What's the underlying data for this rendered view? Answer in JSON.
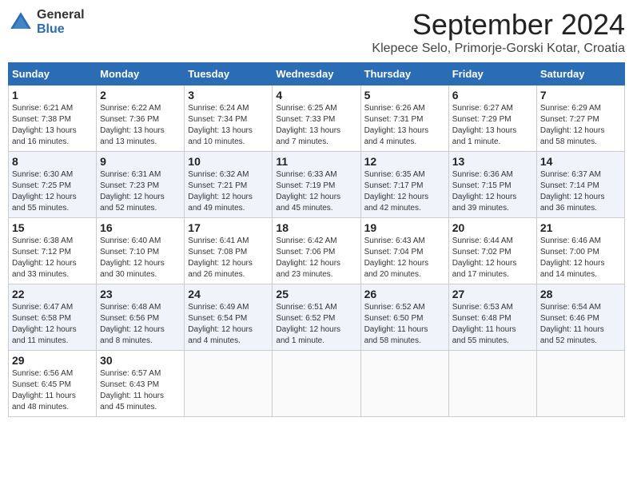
{
  "header": {
    "logo_general": "General",
    "logo_blue": "Blue",
    "month": "September 2024",
    "location": "Klepece Selo, Primorje-Gorski Kotar, Croatia"
  },
  "weekdays": [
    "Sunday",
    "Monday",
    "Tuesday",
    "Wednesday",
    "Thursday",
    "Friday",
    "Saturday"
  ],
  "weeks": [
    [
      {
        "day": "1",
        "info": "Sunrise: 6:21 AM\nSunset: 7:38 PM\nDaylight: 13 hours\nand 16 minutes."
      },
      {
        "day": "2",
        "info": "Sunrise: 6:22 AM\nSunset: 7:36 PM\nDaylight: 13 hours\nand 13 minutes."
      },
      {
        "day": "3",
        "info": "Sunrise: 6:24 AM\nSunset: 7:34 PM\nDaylight: 13 hours\nand 10 minutes."
      },
      {
        "day": "4",
        "info": "Sunrise: 6:25 AM\nSunset: 7:33 PM\nDaylight: 13 hours\nand 7 minutes."
      },
      {
        "day": "5",
        "info": "Sunrise: 6:26 AM\nSunset: 7:31 PM\nDaylight: 13 hours\nand 4 minutes."
      },
      {
        "day": "6",
        "info": "Sunrise: 6:27 AM\nSunset: 7:29 PM\nDaylight: 13 hours\nand 1 minute."
      },
      {
        "day": "7",
        "info": "Sunrise: 6:29 AM\nSunset: 7:27 PM\nDaylight: 12 hours\nand 58 minutes."
      }
    ],
    [
      {
        "day": "8",
        "info": "Sunrise: 6:30 AM\nSunset: 7:25 PM\nDaylight: 12 hours\nand 55 minutes."
      },
      {
        "day": "9",
        "info": "Sunrise: 6:31 AM\nSunset: 7:23 PM\nDaylight: 12 hours\nand 52 minutes."
      },
      {
        "day": "10",
        "info": "Sunrise: 6:32 AM\nSunset: 7:21 PM\nDaylight: 12 hours\nand 49 minutes."
      },
      {
        "day": "11",
        "info": "Sunrise: 6:33 AM\nSunset: 7:19 PM\nDaylight: 12 hours\nand 45 minutes."
      },
      {
        "day": "12",
        "info": "Sunrise: 6:35 AM\nSunset: 7:17 PM\nDaylight: 12 hours\nand 42 minutes."
      },
      {
        "day": "13",
        "info": "Sunrise: 6:36 AM\nSunset: 7:15 PM\nDaylight: 12 hours\nand 39 minutes."
      },
      {
        "day": "14",
        "info": "Sunrise: 6:37 AM\nSunset: 7:14 PM\nDaylight: 12 hours\nand 36 minutes."
      }
    ],
    [
      {
        "day": "15",
        "info": "Sunrise: 6:38 AM\nSunset: 7:12 PM\nDaylight: 12 hours\nand 33 minutes."
      },
      {
        "day": "16",
        "info": "Sunrise: 6:40 AM\nSunset: 7:10 PM\nDaylight: 12 hours\nand 30 minutes."
      },
      {
        "day": "17",
        "info": "Sunrise: 6:41 AM\nSunset: 7:08 PM\nDaylight: 12 hours\nand 26 minutes."
      },
      {
        "day": "18",
        "info": "Sunrise: 6:42 AM\nSunset: 7:06 PM\nDaylight: 12 hours\nand 23 minutes."
      },
      {
        "day": "19",
        "info": "Sunrise: 6:43 AM\nSunset: 7:04 PM\nDaylight: 12 hours\nand 20 minutes."
      },
      {
        "day": "20",
        "info": "Sunrise: 6:44 AM\nSunset: 7:02 PM\nDaylight: 12 hours\nand 17 minutes."
      },
      {
        "day": "21",
        "info": "Sunrise: 6:46 AM\nSunset: 7:00 PM\nDaylight: 12 hours\nand 14 minutes."
      }
    ],
    [
      {
        "day": "22",
        "info": "Sunrise: 6:47 AM\nSunset: 6:58 PM\nDaylight: 12 hours\nand 11 minutes."
      },
      {
        "day": "23",
        "info": "Sunrise: 6:48 AM\nSunset: 6:56 PM\nDaylight: 12 hours\nand 8 minutes."
      },
      {
        "day": "24",
        "info": "Sunrise: 6:49 AM\nSunset: 6:54 PM\nDaylight: 12 hours\nand 4 minutes."
      },
      {
        "day": "25",
        "info": "Sunrise: 6:51 AM\nSunset: 6:52 PM\nDaylight: 12 hours\nand 1 minute."
      },
      {
        "day": "26",
        "info": "Sunrise: 6:52 AM\nSunset: 6:50 PM\nDaylight: 11 hours\nand 58 minutes."
      },
      {
        "day": "27",
        "info": "Sunrise: 6:53 AM\nSunset: 6:48 PM\nDaylight: 11 hours\nand 55 minutes."
      },
      {
        "day": "28",
        "info": "Sunrise: 6:54 AM\nSunset: 6:46 PM\nDaylight: 11 hours\nand 52 minutes."
      }
    ],
    [
      {
        "day": "29",
        "info": "Sunrise: 6:56 AM\nSunset: 6:45 PM\nDaylight: 11 hours\nand 48 minutes."
      },
      {
        "day": "30",
        "info": "Sunrise: 6:57 AM\nSunset: 6:43 PM\nDaylight: 11 hours\nand 45 minutes."
      },
      null,
      null,
      null,
      null,
      null
    ]
  ]
}
